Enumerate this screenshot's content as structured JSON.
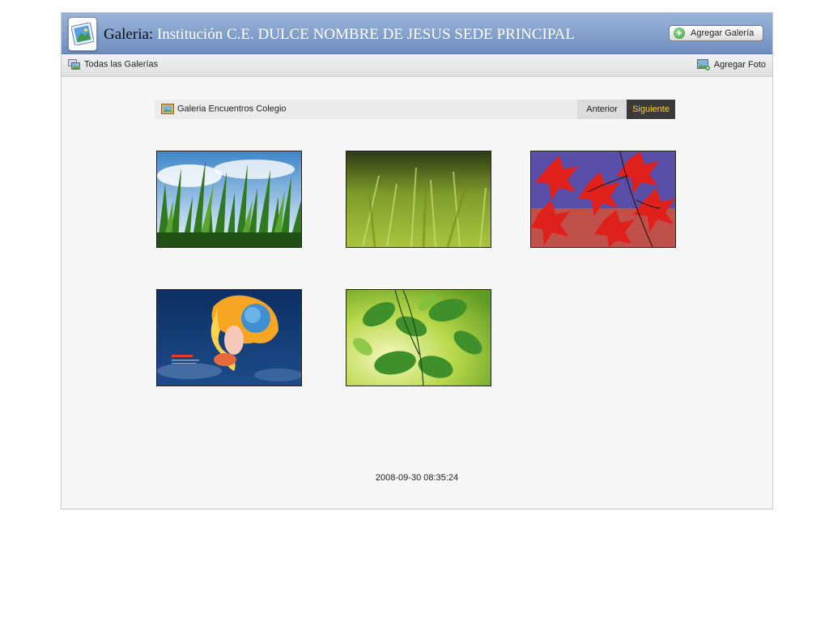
{
  "header": {
    "title_label": "Galeria:",
    "title_value": " Institución C.E. DULCE NOMBRE DE JESUS SEDE PRINCIPAL",
    "add_gallery_label": "Agregar Galería",
    "add_gallery_icon": "plus-circle-icon",
    "app_icon": "picture-frame-icon"
  },
  "toolbar": {
    "all_galleries_label": "Todas las Galerías",
    "all_galleries_icon": "galleries-icon",
    "add_photo_label": "Agregar Foto",
    "add_photo_icon": "add-photo-icon"
  },
  "gallery": {
    "name": "Galeria Encuentros Colegio",
    "name_icon": "picture-icon",
    "prev_label": "Anterior",
    "next_label": "Siguiente"
  },
  "photos": [
    {
      "subject": "grass-sky"
    },
    {
      "subject": "green-grass-blur"
    },
    {
      "subject": "red-maple-leaves"
    },
    {
      "subject": "firefox-wallpaper"
    },
    {
      "subject": "green-leaves"
    }
  ],
  "footer": {
    "timestamp": "2008-09-30 08:35:24"
  },
  "colors": {
    "header_top": "#9ab4d8",
    "header_bottom": "#6f8fc0",
    "next_bg": "#3a3a3a",
    "next_text": "#f6d33a"
  }
}
